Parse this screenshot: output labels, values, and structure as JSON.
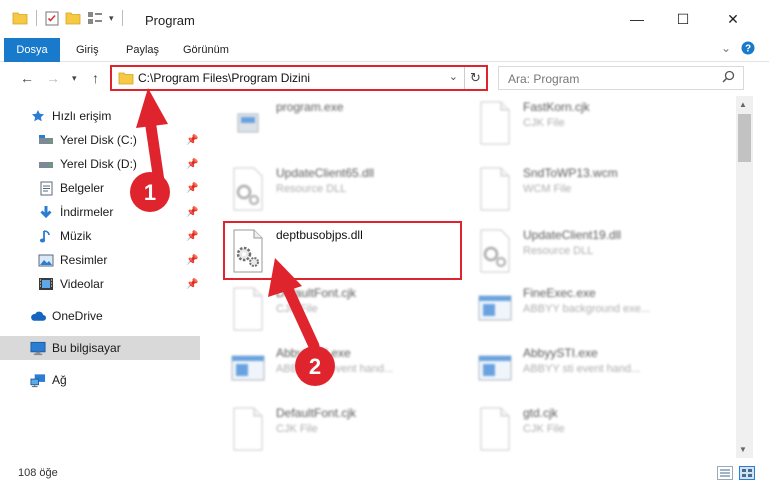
{
  "window": {
    "title": "Program",
    "controls": {
      "minimize": "—",
      "maximize": "☐",
      "close": "✕"
    }
  },
  "ribbon": {
    "tabs": [
      {
        "label": "Dosya",
        "active": true
      },
      {
        "label": "Giriş"
      },
      {
        "label": "Paylaş"
      },
      {
        "label": "Görünüm"
      }
    ],
    "expand_icon": "chevron-down-icon",
    "help_icon": "help-icon"
  },
  "address": {
    "path": "C:\\Program Files\\Program Dizini",
    "search_placeholder": "Ara: Program"
  },
  "sidebar": {
    "items": [
      {
        "label": "Hızlı erişim",
        "icon": "star-icon",
        "pinned": false
      },
      {
        "label": "Yerel Disk (C:)",
        "icon": "drive-icon",
        "pinned": true
      },
      {
        "label": "Yerel Disk (D:)",
        "icon": "drive-icon",
        "pinned": true
      },
      {
        "label": "Belgeler",
        "icon": "documents-icon",
        "pinned": true
      },
      {
        "label": "İndirmeler",
        "icon": "download-icon",
        "pinned": true
      },
      {
        "label": "Müzik",
        "icon": "music-icon",
        "pinned": true
      },
      {
        "label": "Resimler",
        "icon": "pictures-icon",
        "pinned": true
      },
      {
        "label": "Videolar",
        "icon": "videos-icon",
        "pinned": true
      },
      {
        "label": "OneDrive",
        "icon": "cloud-icon",
        "pinned": false
      },
      {
        "label": "Bu bilgisayar",
        "icon": "computer-icon",
        "pinned": false,
        "selected": true
      },
      {
        "label": "Ağ",
        "icon": "network-icon",
        "pinned": false
      }
    ]
  },
  "files": [
    {
      "name": "program.exe",
      "type": "",
      "icon": "exe-icon",
      "blurred": true
    },
    {
      "name": "FastKorn.cjk",
      "type": "CJK File",
      "icon": "blank-file-icon",
      "blurred": true
    },
    {
      "name": "UpdateClient65.dll",
      "type": "Resource DLL",
      "icon": "dll-icon",
      "blurred": true
    },
    {
      "name": "SndToWP13.wcm",
      "type": "WCM File",
      "icon": "blank-file-icon",
      "blurred": true
    },
    {
      "name": "deptbusobjps.dll",
      "type": "",
      "icon": "dll-icon",
      "blurred": false
    },
    {
      "name": "UpdateClient19.dll",
      "type": "Resource DLL",
      "icon": "dll-icon",
      "blurred": true
    },
    {
      "name": "DefaultFont.cjk",
      "type": "CJK File",
      "icon": "blank-file-icon",
      "blurred": true
    },
    {
      "name": "FineExec.exe",
      "type": "ABBYY background exe...",
      "icon": "app-window-icon",
      "blurred": true
    },
    {
      "name": "AbbyySTI.exe",
      "type": "ABBYY sti event hand...",
      "icon": "app-window-icon",
      "blurred": true
    },
    {
      "name": "AbbyySTI.exe",
      "type": "ABBYY sti event hand...",
      "icon": "app-window-icon",
      "blurred": true
    },
    {
      "name": "DefaultFont.cjk",
      "type": "CJK File",
      "icon": "blank-file-icon",
      "blurred": true
    },
    {
      "name": "gtd.cjk",
      "type": "CJK File",
      "icon": "blank-file-icon",
      "blurred": true
    }
  ],
  "annotations": {
    "step1": "1",
    "step2": "2",
    "highlight_color": "#e0242e"
  },
  "status": {
    "count": "108 öğe"
  },
  "colors": {
    "accent": "#1979ca",
    "annotation": "#e0242e"
  }
}
